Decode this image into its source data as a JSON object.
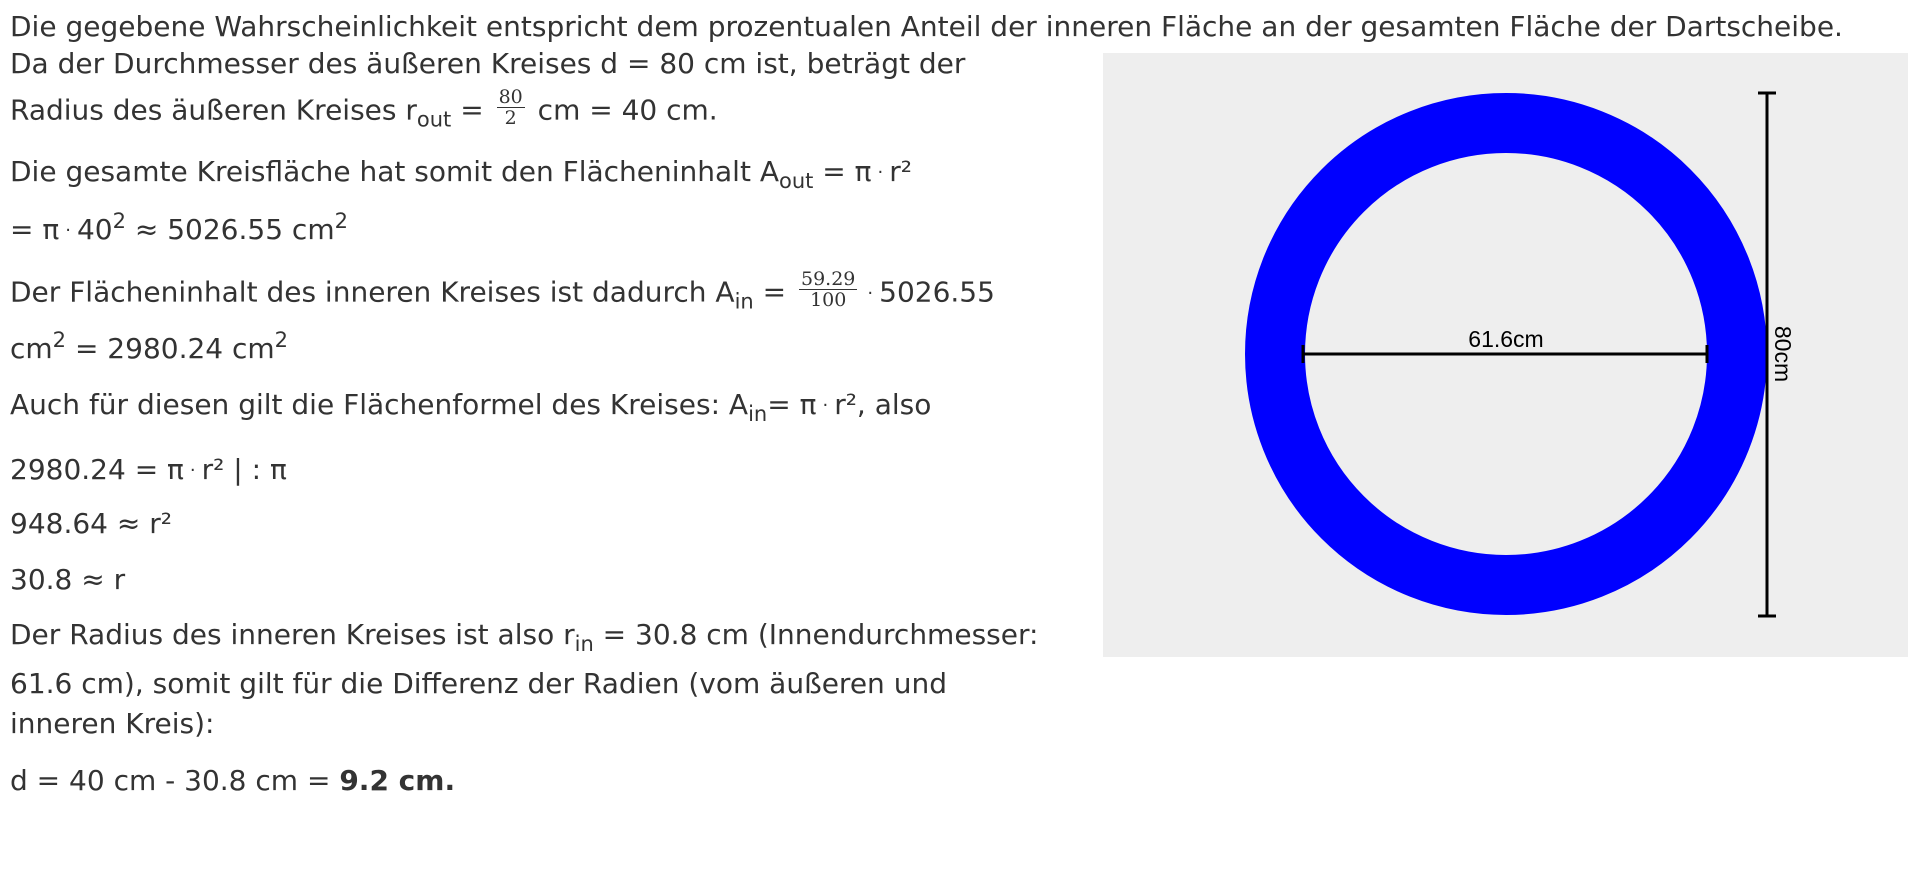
{
  "lines": {
    "l1": "Die gegebene Wahrscheinlichkeit entspricht dem prozentualen Anteil der inneren Fläche an der gesamten Fläche der Dartscheibe.",
    "l2": "Da der Durchmesser des äußeren Kreises d = 80 cm ist, beträgt der",
    "l3_a": "Radius des äußeren Kreises r",
    "l3_sub": "out",
    "l3_b": " =",
    "l3_frac_num": "80",
    "l3_frac_den": "2",
    "l3_c": " cm = 40 cm.",
    "l4_a": "Die gesamte Kreisfläche hat somit den Flächeninhalt A",
    "l4_sub": "out",
    "l4_b": " = π",
    "l4_dot": "·",
    "l4_c": "r²",
    "l5_a": "= π",
    "l5_dot": "·",
    "l5_b": "40",
    "l5_sup": "2",
    "l5_c": " ≈ 5026.55 cm",
    "l5_sup2": "2",
    "l6_a": "Der Flächeninhalt des inneren Kreises ist dadurch A",
    "l6_sub": "in",
    "l6_b": " =",
    "l6_frac_num": "59.29",
    "l6_frac_den": "100",
    "l6_dot": "·",
    "l6_c": "5026.55",
    "l7_a": "cm",
    "l7_sup": "2",
    "l7_b": " = 2980.24 cm",
    "l7_sup2": "2",
    "l8_a": "Auch für diesen gilt die Flächenformel des Kreises: A",
    "l8_sub": "in",
    "l8_b": "= π",
    "l8_dot": "·",
    "l8_c": "r², also",
    "l9_a": "2980.24 = π",
    "l9_dot": "·",
    "l9_b": "r² | : π",
    "l10": "948.64 ≈ r²",
    "l11": "30.8 ≈ r",
    "l12_a": "Der Radius des inneren Kreises ist also r",
    "l12_sub": "in",
    "l12_b": " = 30.8 cm (Innendurchmesser:",
    "l13": "61.6 cm), somit gilt für die Differenz der Radien (vom äußeren und",
    "l14": "inneren Kreis):",
    "l15_a": "d = 40 cm - 30.8 cm = ",
    "l15_bold": "9.2 cm."
  },
  "figure": {
    "inner_label": "61.6cm",
    "outer_label": "80cm",
    "outer_diameter_cm": 80,
    "inner_diameter_cm": 61.6,
    "ring_color": "#0000ff",
    "background_color": "#eeeeee"
  }
}
